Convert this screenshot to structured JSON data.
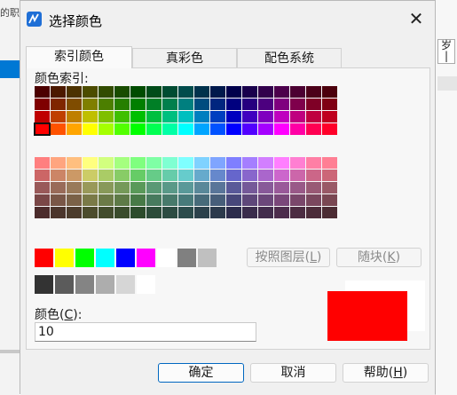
{
  "background": {
    "fragment_text": "的职",
    "right_glyph": "岁\n|"
  },
  "dialog": {
    "title": "选择颜色",
    "close_glyph": "✕",
    "tabs": [
      {
        "label": "索引颜色",
        "active": true
      },
      {
        "label": "真彩色",
        "active": false
      },
      {
        "label": "配色系统",
        "active": false
      }
    ],
    "index_label": "颜色索引:",
    "color_label_prefix": "颜色(",
    "color_label_key": "C",
    "color_label_suffix": "):",
    "color_value": "10",
    "bylayer_prefix": "按照图层(",
    "bylayer_key": "L",
    "bylayer_suffix": ")",
    "byblock_prefix": "随块(",
    "byblock_key": "K",
    "byblock_suffix": ")",
    "ok_label": "确定",
    "cancel_label": "取消",
    "help_prefix": "帮助(",
    "help_key": "H",
    "help_suffix": ")",
    "selected_color": "#ff0000",
    "selected_index_in_top_palette": "row 4, column 1"
  },
  "palette": {
    "top_rows": [
      [
        "#4c0000",
        "#4c1900",
        "#4c3200",
        "#4c4c00",
        "#324c00",
        "#194c00",
        "#004c00",
        "#004c19",
        "#004c32",
        "#004c4c",
        "#00324c",
        "#00194c",
        "#00004c",
        "#19004c",
        "#32004c",
        "#4c004c",
        "#4c0032",
        "#4c0019",
        "#4c000c"
      ],
      [
        "#7f0000",
        "#7f2600",
        "#7f4c00",
        "#7f7f00",
        "#4c7f00",
        "#267f00",
        "#007f00",
        "#007f26",
        "#007f4c",
        "#007f7f",
        "#004c7f",
        "#00267f",
        "#00007f",
        "#26007f",
        "#4c007f",
        "#7f007f",
        "#7f004c",
        "#7f0026",
        "#7f0013"
      ],
      [
        "#bf0000",
        "#bf3f00",
        "#bf7f00",
        "#bfbf00",
        "#7fbf00",
        "#3fbf00",
        "#00bf00",
        "#00bf3f",
        "#00bf7f",
        "#00bfbf",
        "#007fbf",
        "#003fbf",
        "#0000bf",
        "#3f00bf",
        "#7f00bf",
        "#bf00bf",
        "#bf007f",
        "#bf003f",
        "#bf001f"
      ],
      [
        "#ff0000",
        "#ff5200",
        "#ffa500",
        "#ffff00",
        "#a5ff00",
        "#52ff00",
        "#00ff00",
        "#00ff52",
        "#00ffa5",
        "#00ffff",
        "#00a5ff",
        "#0052ff",
        "#0000ff",
        "#5200ff",
        "#a500ff",
        "#ff00ff",
        "#ff00a5",
        "#ff0052",
        "#ff0029"
      ]
    ],
    "bottom_rows": [
      [
        "#ff7f7f",
        "#ffa57f",
        "#ffbf7f",
        "#ffff7f",
        "#d2ff7f",
        "#a5ff7f",
        "#7fff7f",
        "#7fffa5",
        "#7fffd2",
        "#7fffff",
        "#7fd2ff",
        "#7fa5ff",
        "#7f7fff",
        "#a57fff",
        "#d27fff",
        "#ff7fff",
        "#ff7fd2",
        "#ff7fa5",
        "#ff7f94"
      ],
      [
        "#cc6666",
        "#cc8566",
        "#cc9966",
        "#cccc66",
        "#aacc66",
        "#88cc66",
        "#66cc66",
        "#66cc88",
        "#66ccaa",
        "#66cccc",
        "#66aacc",
        "#6688cc",
        "#6666cc",
        "#8866cc",
        "#aa66cc",
        "#cc66cc",
        "#cc66aa",
        "#cc6688",
        "#cc6677"
      ],
      [
        "#995959",
        "#996b59",
        "#997a59",
        "#999959",
        "#889959",
        "#759959",
        "#599959",
        "#599975",
        "#599988",
        "#599999",
        "#598899",
        "#597599",
        "#595999",
        "#755999",
        "#885999",
        "#995999",
        "#995988",
        "#995975",
        "#995966"
      ],
      [
        "#7a4747",
        "#7a5747",
        "#7a6147",
        "#7a7a47",
        "#6b7a47",
        "#5e7a47",
        "#477a47",
        "#477a5e",
        "#477a6b",
        "#477a7a",
        "#476b7a",
        "#475e7a",
        "#47477a",
        "#5e477a",
        "#6b477a",
        "#7a477a",
        "#7a476b",
        "#7a475e",
        "#7a4752"
      ],
      [
        "#4c2c2c",
        "#4c362c",
        "#4c3c2c",
        "#4c4c2c",
        "#424c2c",
        "#3a4c2c",
        "#2c4c2c",
        "#2c4c3a",
        "#2c4c42",
        "#2c4c4c",
        "#2c424c",
        "#2c3a4c",
        "#2c2c4c",
        "#3a2c4c",
        "#422c4c",
        "#4c2c4c",
        "#4c2c42",
        "#4c2c3a",
        "#4c2c33"
      ]
    ],
    "standard": [
      "#ff0000",
      "#ffff00",
      "#00ff00",
      "#00ffff",
      "#0000ff",
      "#ff00ff",
      "#ffffff",
      "#808080",
      "#c0c0c0"
    ],
    "grays": [
      "#333333",
      "#5b5b5b",
      "#848484",
      "#adadad",
      "#d6d6d6",
      "#ffffff"
    ]
  }
}
